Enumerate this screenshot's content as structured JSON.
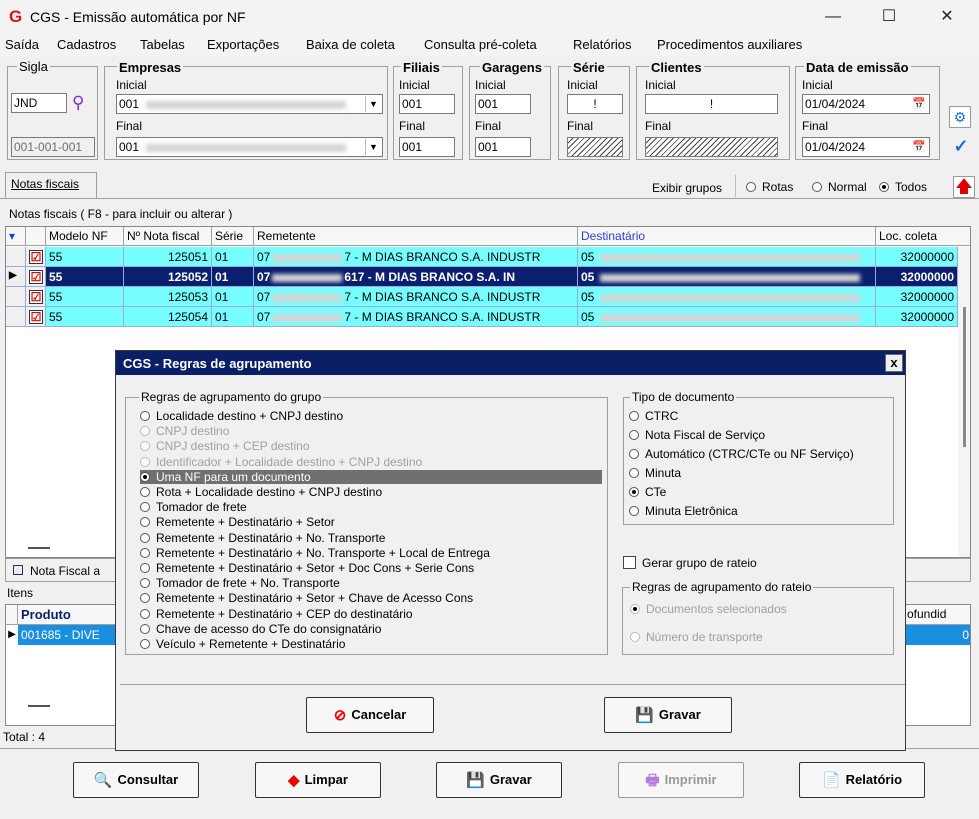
{
  "window": {
    "title": "CGS - Emissão automática por NF",
    "logo": "G",
    "controls": [
      "—",
      "☐",
      "✕"
    ]
  },
  "menu": [
    "Saída",
    "Cadastros",
    "Tabelas",
    "Exportações",
    "Baixa de coleta",
    "Consulta pré-coleta",
    "Relatórios",
    "Procedimentos auxiliares"
  ],
  "filters": {
    "sigla": {
      "label": "Sigla",
      "value": "JND",
      "code": "001-001-001"
    },
    "empresas": {
      "label": "Empresas",
      "inicial_label": "Inicial",
      "final_label": "Final",
      "inicial": "001",
      "final": "001"
    },
    "filiais": {
      "label": "Filiais",
      "inicial_label": "Inicial",
      "final_label": "Final",
      "inicial": "001",
      "final": "001"
    },
    "garagens": {
      "label": "Garagens",
      "inicial_label": "Inicial",
      "final_label": "Final",
      "inicial": "001",
      "final": "001"
    },
    "serie": {
      "label": "Série",
      "inicial_label": "Inicial",
      "final_label": "Final",
      "inicial": "!"
    },
    "clientes": {
      "label": "Clientes",
      "inicial_label": "Inicial",
      "final_label": "Final",
      "inicial": "!"
    },
    "data_emissao": {
      "label": "Data de emissão",
      "inicial_label": "Inicial",
      "final_label": "Final",
      "inicial": "01/04/2024",
      "final": "01/04/2024"
    }
  },
  "tabs": {
    "notas": "Notas fiscais"
  },
  "grupos": {
    "label": "Exibir grupos",
    "options": [
      "Rotas",
      "Normal",
      "Todos"
    ],
    "selected": "Todos"
  },
  "grid": {
    "caption": "Notas fiscais ( F8 - para incluir ou alterar )",
    "headers": [
      "Modelo NF",
      "Nº Nota fiscal",
      "Série",
      "Remetente",
      "Destinatário",
      "Loc. coleta"
    ],
    "rows": [
      {
        "modelo": "55",
        "nota": "125051",
        "serie": "01",
        "rem_prefix": "07",
        "rem_text": "7 - M DIAS BRANCO S.A. INDUSTR",
        "dest": "05",
        "loc": "32000000"
      },
      {
        "modelo": "55",
        "nota": "125052",
        "serie": "01",
        "rem_prefix": "07",
        "rem_text": "617 - M DIAS BRANCO S.A. IN",
        "dest": "05",
        "loc": "32000000"
      },
      {
        "modelo": "55",
        "nota": "125053",
        "serie": "01",
        "rem_prefix": "07",
        "rem_text": "7 - M DIAS BRANCO S.A. INDUSTR",
        "dest": "05",
        "loc": "32000000"
      },
      {
        "modelo": "55",
        "nota": "125054",
        "serie": "01",
        "rem_prefix": "07",
        "rem_text": "7 - M DIAS BRANCO S.A. INDUSTR",
        "dest": "05",
        "loc": "32000000"
      }
    ]
  },
  "lower": {
    "nota_fiscal_tab": "Nota Fiscal a",
    "itens_label": "Itens",
    "produto_header": "Produto",
    "produto_value": "001685 - DIVE",
    "profundidade_header": "ofundid",
    "profundidade_value": "0",
    "total": "Total : 4"
  },
  "dialog": {
    "title": "CGS - Regras de agrupamento",
    "close": "x",
    "regras_group_label": "Regras de agrupamento do grupo",
    "regras": [
      {
        "label": "Localidade destino + CNPJ destino",
        "disabled": false
      },
      {
        "label": "CNPJ destino",
        "disabled": true
      },
      {
        "label": "CNPJ destino + CEP destino",
        "disabled": true
      },
      {
        "label": "Identificador + Localidade destino + CNPJ destino",
        "disabled": true
      },
      {
        "label": "Uma NF para um documento",
        "disabled": false,
        "selected": true
      },
      {
        "label": "Rota + Localidade destino + CNPJ destino",
        "disabled": false
      },
      {
        "label": "Tomador de frete",
        "disabled": false
      },
      {
        "label": "Remetente + Destinatário + Setor",
        "disabled": false
      },
      {
        "label": "Remetente + Destinatário + No. Transporte",
        "disabled": false
      },
      {
        "label": "Remetente + Destinatário + No. Transporte + Local de Entrega",
        "disabled": false
      },
      {
        "label": "Remetente + Destinatário + Setor + Doc Cons + Serie Cons",
        "disabled": false
      },
      {
        "label": "Tomador de frete + No. Transporte",
        "disabled": false
      },
      {
        "label": "Remetente + Destinatário + Setor + Chave de Acesso Cons",
        "disabled": false
      },
      {
        "label": "Remetente + Destinatário + CEP do destinatário",
        "disabled": false
      },
      {
        "label": "Chave de acesso do CTe do consignatário",
        "disabled": false
      },
      {
        "label": "Veículo + Remetente + Destinatário",
        "disabled": false
      }
    ],
    "tipo_label": "Tipo de documento",
    "tipos": [
      {
        "label": "CTRC"
      },
      {
        "label": "Nota Fiscal de Serviço"
      },
      {
        "label": "Automático (CTRC/CTe ou NF Serviço)"
      },
      {
        "label": "Minuta"
      },
      {
        "label": "CTe",
        "selected": true
      },
      {
        "label": "Minuta Eletrônica"
      }
    ],
    "gerar_rateio": "Gerar grupo de rateio",
    "rateio_label": "Regras de agrupamento do rateio",
    "rateio": [
      {
        "label": "Documentos selecionados",
        "selected": true
      },
      {
        "label": "Número de transporte"
      }
    ],
    "cancel_label": "Cancelar",
    "save_label": "Gravar"
  },
  "bottom_buttons": {
    "consultar": "Consultar",
    "limpar": "Limpar",
    "gravar": "Gravar",
    "imprimir": "Imprimir",
    "relatorio": "Relatório"
  },
  "colors": {
    "accent": "#0b1f66",
    "row_highlight": "#77ffff",
    "selected_row": "#0a1f6e"
  }
}
